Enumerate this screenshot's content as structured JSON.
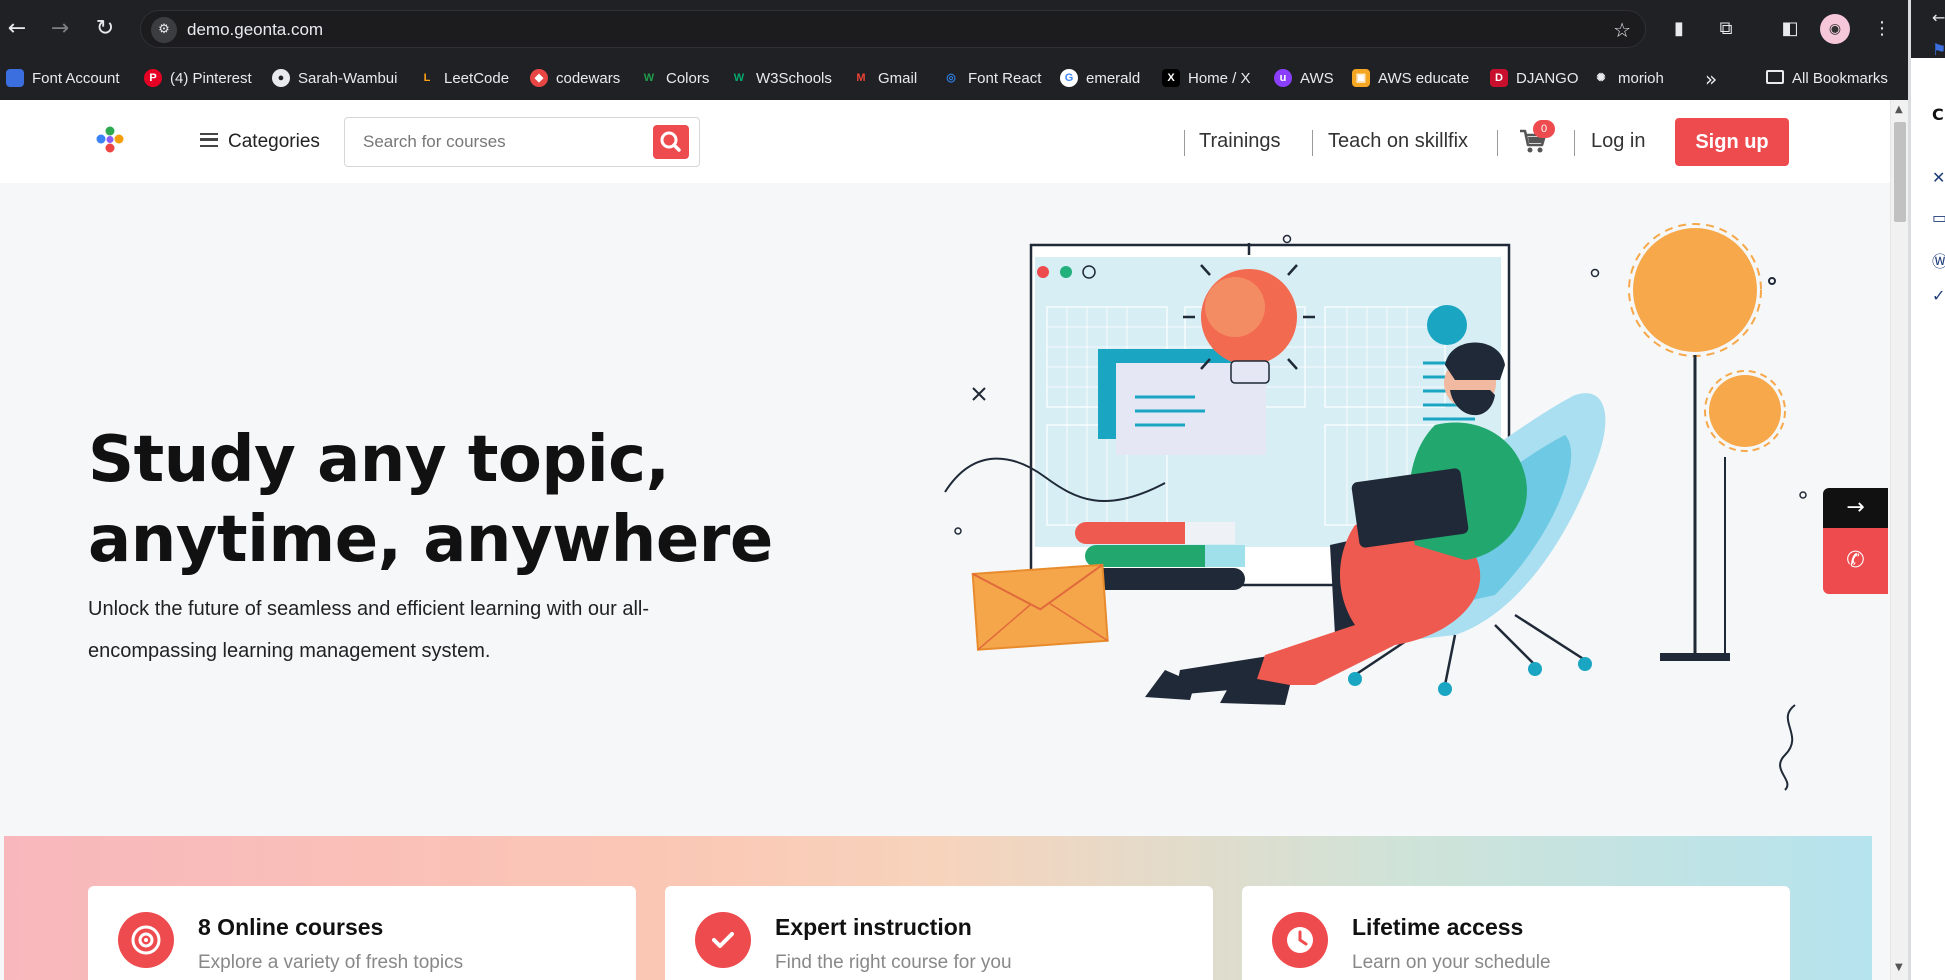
{
  "browser": {
    "url": "demo.geonta.com",
    "bookmarks": [
      {
        "label": "Font Account",
        "icon": "flag-icon",
        "color": "#3b6fe0"
      },
      {
        "label": "(4) Pinterest",
        "icon": "pinterest-icon",
        "color": "#e60023"
      },
      {
        "label": "Sarah-Wambui",
        "icon": "github-icon",
        "color": "#e8eaed"
      },
      {
        "label": "LeetCode",
        "icon": "leetcode-icon",
        "color": "#ffa116"
      },
      {
        "label": "codewars",
        "icon": "codewars-icon",
        "color": "#e84545"
      },
      {
        "label": "Colors",
        "icon": "colors-icon",
        "color": "#1e9d4c"
      },
      {
        "label": "W3Schools",
        "icon": "w3schools-icon",
        "color": "#04aa6d"
      },
      {
        "label": "Gmail",
        "icon": "gmail-icon",
        "color": "#ea4335"
      },
      {
        "label": "Font React",
        "icon": "react-icon",
        "color": "#2f7de1"
      },
      {
        "label": "emerald",
        "icon": "google-icon",
        "color": "#4285f4"
      },
      {
        "label": "Home / X",
        "icon": "x-icon",
        "color": "#000000"
      },
      {
        "label": "AWS",
        "icon": "aws-icon",
        "color": "#8a3ffc"
      },
      {
        "label": "AWS educate",
        "icon": "aws-educate-icon",
        "color": "#f5a623"
      },
      {
        "label": "DJANGO",
        "icon": "django-icon",
        "color": "#c8102e"
      },
      {
        "label": "morioh",
        "icon": "morioh-icon",
        "color": "#e8eaed"
      }
    ],
    "more_label": "»",
    "all_bookmarks_label": "All Bookmarks"
  },
  "header": {
    "categories_label": "Categories",
    "search_placeholder": "Search for courses",
    "nav": {
      "trainings": "Trainings",
      "teach": "Teach on skillfix",
      "cart_count": "0",
      "login": "Log in",
      "signup": "Sign up"
    }
  },
  "hero": {
    "title_line1": "Study any topic,",
    "title_line2": "anytime, anywhere",
    "subtitle": "Unlock the future of seamless and efficient learning with our all-encompassing learning management system."
  },
  "floating": {
    "arrow": "→",
    "whatsapp_icon": "whatsapp-icon"
  },
  "features": [
    {
      "title": "8 Online courses",
      "subtitle": "Explore a variety of fresh topics",
      "icon": "target-icon"
    },
    {
      "title": "Expert instruction",
      "subtitle": "Find the right course for you",
      "icon": "check-icon"
    },
    {
      "title": "Lifetime access",
      "subtitle": "Learn on your schedule",
      "icon": "clock-icon"
    }
  ],
  "colors": {
    "accent": "#ee4b4e",
    "page_bg": "#f6f7f9",
    "chrome_bg": "#202124"
  }
}
